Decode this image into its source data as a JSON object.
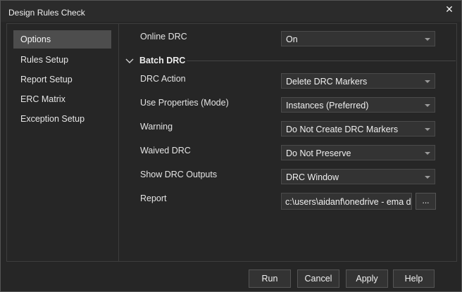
{
  "window": {
    "title": "Design Rules Check",
    "close_glyph": "✕"
  },
  "sidebar": {
    "items": [
      {
        "label": "Options",
        "selected": true
      },
      {
        "label": "Rules Setup"
      },
      {
        "label": "Report Setup"
      },
      {
        "label": "ERC Matrix"
      },
      {
        "label": "Exception Setup"
      }
    ]
  },
  "options": {
    "online_drc": {
      "label": "Online DRC",
      "value": "On"
    },
    "batch_section": "Batch DRC",
    "fields": [
      {
        "label": "DRC Action",
        "value": "Delete DRC Markers"
      },
      {
        "label": "Use Properties (Mode)",
        "value": "Instances (Preferred)"
      },
      {
        "label": "Warning",
        "value": "Do Not Create DRC Markers"
      },
      {
        "label": "Waived DRC",
        "value": "Do Not Preserve"
      },
      {
        "label": "Show DRC Outputs",
        "value": "DRC Window"
      }
    ],
    "report": {
      "label": "Report",
      "value": "c:\\users\\aidanf\\onedrive - ema design",
      "browse_label": "..."
    }
  },
  "buttons": {
    "run": "Run",
    "cancel": "Cancel",
    "apply": "Apply",
    "help": "Help"
  },
  "icons": {
    "close": "close-icon",
    "chevron": "chevron-down-icon",
    "dropdown": "dropdown-arrow-icon"
  }
}
